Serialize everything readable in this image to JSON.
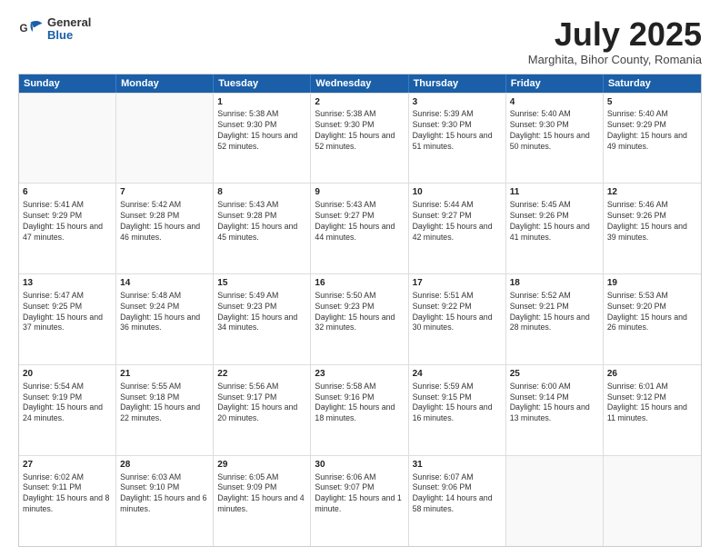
{
  "header": {
    "logo": {
      "general": "General",
      "blue": "Blue"
    },
    "title": "July 2025",
    "location": "Marghita, Bihor County, Romania"
  },
  "days_of_week": [
    "Sunday",
    "Monday",
    "Tuesday",
    "Wednesday",
    "Thursday",
    "Friday",
    "Saturday"
  ],
  "weeks": [
    [
      {
        "day": "",
        "sunrise": "",
        "sunset": "",
        "daylight": "",
        "empty": true
      },
      {
        "day": "",
        "sunrise": "",
        "sunset": "",
        "daylight": "",
        "empty": true
      },
      {
        "day": "1",
        "sunrise": "Sunrise: 5:38 AM",
        "sunset": "Sunset: 9:30 PM",
        "daylight": "Daylight: 15 hours and 52 minutes.",
        "empty": false
      },
      {
        "day": "2",
        "sunrise": "Sunrise: 5:38 AM",
        "sunset": "Sunset: 9:30 PM",
        "daylight": "Daylight: 15 hours and 52 minutes.",
        "empty": false
      },
      {
        "day": "3",
        "sunrise": "Sunrise: 5:39 AM",
        "sunset": "Sunset: 9:30 PM",
        "daylight": "Daylight: 15 hours and 51 minutes.",
        "empty": false
      },
      {
        "day": "4",
        "sunrise": "Sunrise: 5:40 AM",
        "sunset": "Sunset: 9:30 PM",
        "daylight": "Daylight: 15 hours and 50 minutes.",
        "empty": false
      },
      {
        "day": "5",
        "sunrise": "Sunrise: 5:40 AM",
        "sunset": "Sunset: 9:29 PM",
        "daylight": "Daylight: 15 hours and 49 minutes.",
        "empty": false
      }
    ],
    [
      {
        "day": "6",
        "sunrise": "Sunrise: 5:41 AM",
        "sunset": "Sunset: 9:29 PM",
        "daylight": "Daylight: 15 hours and 47 minutes.",
        "empty": false
      },
      {
        "day": "7",
        "sunrise": "Sunrise: 5:42 AM",
        "sunset": "Sunset: 9:28 PM",
        "daylight": "Daylight: 15 hours and 46 minutes.",
        "empty": false
      },
      {
        "day": "8",
        "sunrise": "Sunrise: 5:43 AM",
        "sunset": "Sunset: 9:28 PM",
        "daylight": "Daylight: 15 hours and 45 minutes.",
        "empty": false
      },
      {
        "day": "9",
        "sunrise": "Sunrise: 5:43 AM",
        "sunset": "Sunset: 9:27 PM",
        "daylight": "Daylight: 15 hours and 44 minutes.",
        "empty": false
      },
      {
        "day": "10",
        "sunrise": "Sunrise: 5:44 AM",
        "sunset": "Sunset: 9:27 PM",
        "daylight": "Daylight: 15 hours and 42 minutes.",
        "empty": false
      },
      {
        "day": "11",
        "sunrise": "Sunrise: 5:45 AM",
        "sunset": "Sunset: 9:26 PM",
        "daylight": "Daylight: 15 hours and 41 minutes.",
        "empty": false
      },
      {
        "day": "12",
        "sunrise": "Sunrise: 5:46 AM",
        "sunset": "Sunset: 9:26 PM",
        "daylight": "Daylight: 15 hours and 39 minutes.",
        "empty": false
      }
    ],
    [
      {
        "day": "13",
        "sunrise": "Sunrise: 5:47 AM",
        "sunset": "Sunset: 9:25 PM",
        "daylight": "Daylight: 15 hours and 37 minutes.",
        "empty": false
      },
      {
        "day": "14",
        "sunrise": "Sunrise: 5:48 AM",
        "sunset": "Sunset: 9:24 PM",
        "daylight": "Daylight: 15 hours and 36 minutes.",
        "empty": false
      },
      {
        "day": "15",
        "sunrise": "Sunrise: 5:49 AM",
        "sunset": "Sunset: 9:23 PM",
        "daylight": "Daylight: 15 hours and 34 minutes.",
        "empty": false
      },
      {
        "day": "16",
        "sunrise": "Sunrise: 5:50 AM",
        "sunset": "Sunset: 9:23 PM",
        "daylight": "Daylight: 15 hours and 32 minutes.",
        "empty": false
      },
      {
        "day": "17",
        "sunrise": "Sunrise: 5:51 AM",
        "sunset": "Sunset: 9:22 PM",
        "daylight": "Daylight: 15 hours and 30 minutes.",
        "empty": false
      },
      {
        "day": "18",
        "sunrise": "Sunrise: 5:52 AM",
        "sunset": "Sunset: 9:21 PM",
        "daylight": "Daylight: 15 hours and 28 minutes.",
        "empty": false
      },
      {
        "day": "19",
        "sunrise": "Sunrise: 5:53 AM",
        "sunset": "Sunset: 9:20 PM",
        "daylight": "Daylight: 15 hours and 26 minutes.",
        "empty": false
      }
    ],
    [
      {
        "day": "20",
        "sunrise": "Sunrise: 5:54 AM",
        "sunset": "Sunset: 9:19 PM",
        "daylight": "Daylight: 15 hours and 24 minutes.",
        "empty": false
      },
      {
        "day": "21",
        "sunrise": "Sunrise: 5:55 AM",
        "sunset": "Sunset: 9:18 PM",
        "daylight": "Daylight: 15 hours and 22 minutes.",
        "empty": false
      },
      {
        "day": "22",
        "sunrise": "Sunrise: 5:56 AM",
        "sunset": "Sunset: 9:17 PM",
        "daylight": "Daylight: 15 hours and 20 minutes.",
        "empty": false
      },
      {
        "day": "23",
        "sunrise": "Sunrise: 5:58 AM",
        "sunset": "Sunset: 9:16 PM",
        "daylight": "Daylight: 15 hours and 18 minutes.",
        "empty": false
      },
      {
        "day": "24",
        "sunrise": "Sunrise: 5:59 AM",
        "sunset": "Sunset: 9:15 PM",
        "daylight": "Daylight: 15 hours and 16 minutes.",
        "empty": false
      },
      {
        "day": "25",
        "sunrise": "Sunrise: 6:00 AM",
        "sunset": "Sunset: 9:14 PM",
        "daylight": "Daylight: 15 hours and 13 minutes.",
        "empty": false
      },
      {
        "day": "26",
        "sunrise": "Sunrise: 6:01 AM",
        "sunset": "Sunset: 9:12 PM",
        "daylight": "Daylight: 15 hours and 11 minutes.",
        "empty": false
      }
    ],
    [
      {
        "day": "27",
        "sunrise": "Sunrise: 6:02 AM",
        "sunset": "Sunset: 9:11 PM",
        "daylight": "Daylight: 15 hours and 8 minutes.",
        "empty": false
      },
      {
        "day": "28",
        "sunrise": "Sunrise: 6:03 AM",
        "sunset": "Sunset: 9:10 PM",
        "daylight": "Daylight: 15 hours and 6 minutes.",
        "empty": false
      },
      {
        "day": "29",
        "sunrise": "Sunrise: 6:05 AM",
        "sunset": "Sunset: 9:09 PM",
        "daylight": "Daylight: 15 hours and 4 minutes.",
        "empty": false
      },
      {
        "day": "30",
        "sunrise": "Sunrise: 6:06 AM",
        "sunset": "Sunset: 9:07 PM",
        "daylight": "Daylight: 15 hours and 1 minute.",
        "empty": false
      },
      {
        "day": "31",
        "sunrise": "Sunrise: 6:07 AM",
        "sunset": "Sunset: 9:06 PM",
        "daylight": "Daylight: 14 hours and 58 minutes.",
        "empty": false
      },
      {
        "day": "",
        "sunrise": "",
        "sunset": "",
        "daylight": "",
        "empty": true
      },
      {
        "day": "",
        "sunrise": "",
        "sunset": "",
        "daylight": "",
        "empty": true
      }
    ]
  ]
}
